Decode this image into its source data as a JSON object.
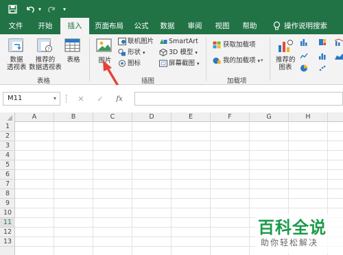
{
  "tabs": [
    "文件",
    "开始",
    "插入",
    "页面布局",
    "公式",
    "数据",
    "审阅",
    "视图",
    "帮助",
    "操作说明搜索"
  ],
  "active_tab": "插入",
  "ribbon": {
    "tables": {
      "recommended_pivot": "数据透视表",
      "recommended_pivot_line1": "数据",
      "recommended_pivot_line2": "透视表",
      "recommended_pivot2_line1": "推荐的",
      "recommended_pivot2_line2": "数据透视表",
      "table": "表格",
      "group": "表格"
    },
    "illustrations": {
      "picture": "图片",
      "online_pictures": "联机图片",
      "shapes": "形状",
      "icons": "图标",
      "smartart": "SmartArt",
      "models3d": "3D 模型",
      "screenshot": "屏幕截图",
      "group": "插图"
    },
    "addins": {
      "get_addins": "获取加载项",
      "my_addins": "我的加载项",
      "group": "加载项"
    },
    "charts": {
      "recommended_line1": "推荐的",
      "recommended_line2": "图表"
    }
  },
  "formula_bar": {
    "name_box": "M11",
    "cancel": "✕",
    "enter": "✓",
    "fx": "fx",
    "value": ""
  },
  "columns": [
    "A",
    "B",
    "C",
    "D",
    "E",
    "F",
    "G",
    "H"
  ],
  "rows": [
    "1",
    "2",
    "3",
    "4",
    "5",
    "6",
    "7",
    "8",
    "9",
    "10",
    "11",
    "12",
    "13"
  ],
  "selected_row": "11",
  "watermark": {
    "main": "百科全说",
    "sub": "助你轻松解决"
  },
  "colors": {
    "brand": "#217346",
    "arrow": "#e8413b",
    "watermark": "#1a9a49"
  }
}
